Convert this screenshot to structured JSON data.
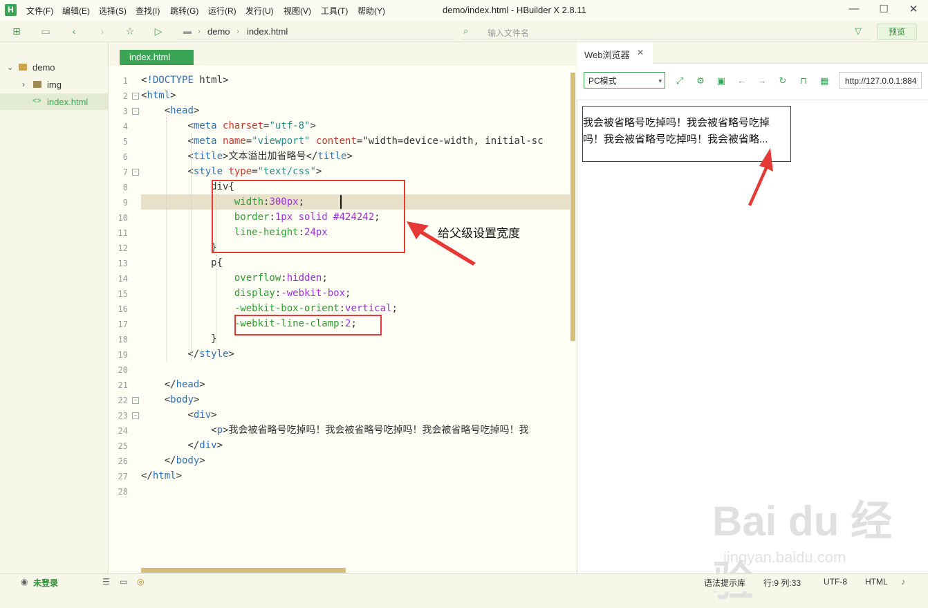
{
  "app": {
    "title": "demo/index.html - HBuilder X 2.8.11",
    "logo": "H",
    "menu": [
      "文件(F)",
      "编辑(E)",
      "选择(S)",
      "查找(I)",
      "跳转(G)",
      "运行(R)",
      "发行(U)",
      "视图(V)",
      "工具(T)",
      "帮助(Y)"
    ]
  },
  "toolbar": {
    "breadcrumb": [
      "demo",
      "index.html"
    ],
    "search_placeholder": "输入文件名",
    "preview_label": "预览"
  },
  "sidebar": {
    "items": [
      {
        "label": "demo",
        "type": "folder",
        "expanded": true
      },
      {
        "label": "img",
        "type": "folder",
        "expanded": false
      },
      {
        "label": "index.html",
        "type": "file",
        "selected": true
      }
    ]
  },
  "editor": {
    "tab_label": "index.html",
    "line_numbers": [
      "1",
      "2",
      "3",
      "4",
      "5",
      "6",
      "7",
      "8",
      "9",
      "10",
      "11",
      "12",
      "13",
      "14",
      "15",
      "16",
      "17",
      "18",
      "19",
      "20",
      "21",
      "22",
      "23",
      "24",
      "25",
      "26",
      "27",
      "28"
    ],
    "lines": [
      "<!DOCTYPE html>",
      "<html>",
      "    <head>",
      "        <meta charset=\"utf-8\">",
      "        <meta name=\"viewport\" content=\"width=device-width, initial-sc",
      "        <title>文本溢出加省略号</title>",
      "        <style type=\"text/css\">",
      "            div{",
      "                width:300px;",
      "                border:1px solid #424242;",
      "                line-height:24px",
      "            }",
      "            p{",
      "                overflow:hidden;",
      "                display:-webkit-box;",
      "                -webkit-box-orient:vertical;",
      "                -webkit-line-clamp:2;",
      "            }",
      "        </style>",
      "",
      "    </head>",
      "    <body>",
      "        <div>",
      "            <p>我会被省略号吃掉吗！我会被省略号吃掉吗！我会被省略号吃掉吗！我",
      "        </div>",
      "    </body>",
      "</html>",
      ""
    ]
  },
  "browser": {
    "tab_label": "Web浏览器",
    "mode_label": "PC模式",
    "url": "http://127.0.0.1:884",
    "content_text": "我会被省略号吃掉吗！我会被省略号吃掉吗！我会被省略号吃掉吗！我会被省略...",
    "line1": "我会被省略号吃掉吗！我会被省略号吃掉",
    "line2": "吗！我会被省略号吃掉吗！我会被省略..."
  },
  "annotation": {
    "text": "给父级设置宽度",
    "color": "#e53935"
  },
  "statusbar": {
    "login": "未登录",
    "syntax_lib": "语法提示库",
    "position": "行:9  列:33",
    "encoding": "UTF-8",
    "language": "HTML"
  },
  "watermark": {
    "brand": "Bai du 经验",
    "url": "jingyan.baidu.com"
  },
  "colors": {
    "accent": "#3aa655",
    "background": "#f6f6e9",
    "scrollbar": "#d4be7a"
  }
}
